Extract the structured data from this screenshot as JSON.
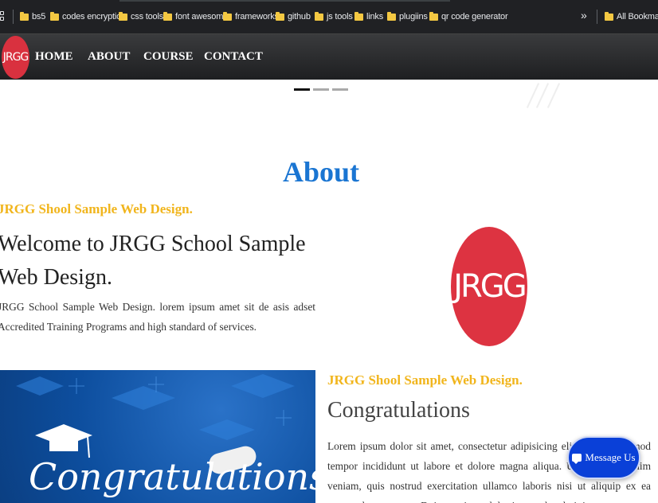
{
  "bookmarks": {
    "items": [
      {
        "label": "bs5"
      },
      {
        "label": "codes encryption"
      },
      {
        "label": "css tools"
      },
      {
        "label": "font awesome"
      },
      {
        "label": "frameworks"
      },
      {
        "label": "github"
      },
      {
        "label": "js tools"
      },
      {
        "label": "links"
      },
      {
        "label": "plugiins"
      },
      {
        "label": "qr code generator"
      }
    ],
    "more": "»",
    "all_bookmarks": "All Bookmarks"
  },
  "nav": {
    "logo": "JRGG",
    "links": [
      "HOME",
      "ABOUT",
      "COURSE",
      "CONTACT"
    ]
  },
  "about": {
    "title": "About",
    "tagline": "JRGG Shool Sample Web Design.",
    "welcome": "Welcome to JRGG School Sample Web Design.",
    "description": "JRGG School Sample Web Design. lorem ipsum amet sit de asis adset Accredited Training Programs and high standard of services.",
    "logo": "JRGG"
  },
  "congrats": {
    "tagline": "JRGG Shool Sample Web Design.",
    "title": "Congratulations",
    "description": "Lorem ipsum dolor sit amet, consectetur adipisicing elit, sed do eiusmod tempor incididunt ut labore et dolore magna aliqua. Ut enim ad minim veniam, quis nostrud exercitation ullamco laboris nisi ut aliquip ex ea commodo consequat. Duis aute irure dolor in reprehenderit in",
    "image_text": "Congratulations"
  },
  "chat": {
    "label": "Message Us"
  }
}
